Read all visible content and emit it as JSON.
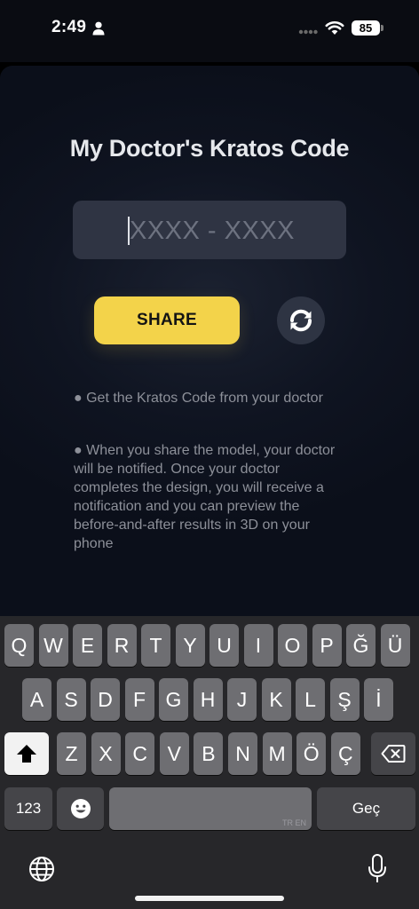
{
  "status_bar": {
    "time": "2:49",
    "battery": "85",
    "icons": [
      "person-icon",
      "signal-dots-icon",
      "wifi-icon",
      "battery-icon"
    ]
  },
  "main": {
    "title": "My Doctor's Kratos Code",
    "code_input": {
      "value": "",
      "placeholder": "XXXX - XXXX"
    },
    "share_label": "SHARE",
    "refresh_icon": "refresh-icon",
    "instructions": [
      "● Get the Kratos Code from your doctor",
      "● When you share the model, your doctor will be notified.  Once your doctor completes the design, you will receive a notification and you can preview the before-and-after results in 3D on your phone"
    ]
  },
  "keyboard": {
    "row1": [
      "Q",
      "W",
      "E",
      "R",
      "T",
      "Y",
      "U",
      "I",
      "O",
      "P",
      "Ğ",
      "Ü"
    ],
    "row2": [
      "A",
      "S",
      "D",
      "F",
      "G",
      "H",
      "J",
      "K",
      "L",
      "Ş",
      "İ"
    ],
    "row3": [
      "Z",
      "X",
      "C",
      "V",
      "B",
      "N",
      "M",
      "Ö",
      "Ç"
    ],
    "numbers_label": "123",
    "return_label": "Geç",
    "space_hint": "TR EN",
    "icons": [
      "shift-icon",
      "delete-icon",
      "emoji-icon",
      "globe-icon",
      "microphone-icon"
    ]
  },
  "colors": {
    "accent": "#f3d34a",
    "background": "#0f1421",
    "field": "#2f3443",
    "keyboard": "#27272a",
    "key": "#6e6e72"
  }
}
